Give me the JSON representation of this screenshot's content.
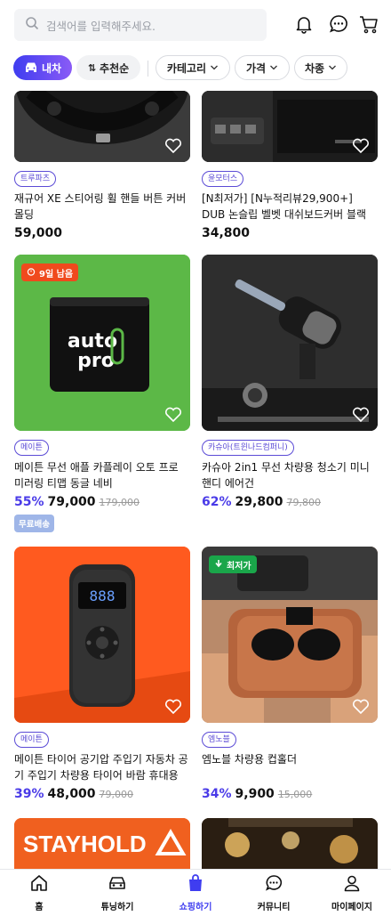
{
  "search": {
    "placeholder": "검색어를 입력해주세요."
  },
  "header": {
    "icons": [
      "bell-icon",
      "chat-icon",
      "cart-icon"
    ]
  },
  "filters": {
    "car_chip": "내차",
    "sort_chip": "추천순",
    "category": "카테고리",
    "price": "가격",
    "car_type": "차종"
  },
  "products": [
    {
      "brand": "트루파츠",
      "title": "재규어 XE 스티어링 휠 핸들 버튼 커버 몰딩",
      "price": "59,000",
      "discount": "",
      "original": ""
    },
    {
      "brand": "윤모터스",
      "title": "[N최저가] [N누적리뷰29,900+] DUB 논슬립 벨벳 대쉬보드커버 블랙 에디션",
      "price": "34,800",
      "discount": "",
      "original": ""
    },
    {
      "brand": "메이튼",
      "title": "메이튼 무선 애플 카플레이 오토 프로 미러링 티맵 동글 네비",
      "price": "79,000",
      "discount": "55%",
      "original": "179,000",
      "badge": "9일 남음",
      "tag": "무료배송",
      "logo_line1": "auto",
      "logo_line2": "pro"
    },
    {
      "brand": "카슈아(트윈나드컴퍼니)",
      "title": "카슈아 2in1 무선 차량용 청소기 미니 핸디 에어건",
      "price": "29,800",
      "discount": "62%",
      "original": "79,800"
    },
    {
      "brand": "메이튼",
      "title": "메이튼 타이어 공기압 주입기 자동차 공기 주입기 차량용 타이어 바람 휴대용",
      "price": "48,000",
      "discount": "39%",
      "original": "79,000",
      "screen_value": "888"
    },
    {
      "brand": "엠노블",
      "title": "엠노블 차량용 컵홀더",
      "price": "9,900",
      "discount": "34%",
      "original": "15,000",
      "badge": "최저가"
    },
    {
      "brand": "",
      "title": "",
      "price": "",
      "discount": "",
      "original": "",
      "logo_text": "STAYHOLD"
    },
    {
      "brand": "",
      "title": "",
      "price": "",
      "discount": "",
      "original": ""
    }
  ],
  "nav": [
    {
      "label": "홈",
      "icon": "home-icon"
    },
    {
      "label": "튜닝하기",
      "icon": "car-icon"
    },
    {
      "label": "쇼핑하기",
      "icon": "shopping-bag-icon",
      "active": true
    },
    {
      "label": "커뮤니티",
      "icon": "community-icon"
    },
    {
      "label": "마이페이지",
      "icon": "person-icon"
    }
  ],
  "colors": {
    "accent": "#3f3df0",
    "discount": "#4a3be8",
    "green_bg": "#5cb847",
    "orange_bg": "#ff5a1f"
  }
}
